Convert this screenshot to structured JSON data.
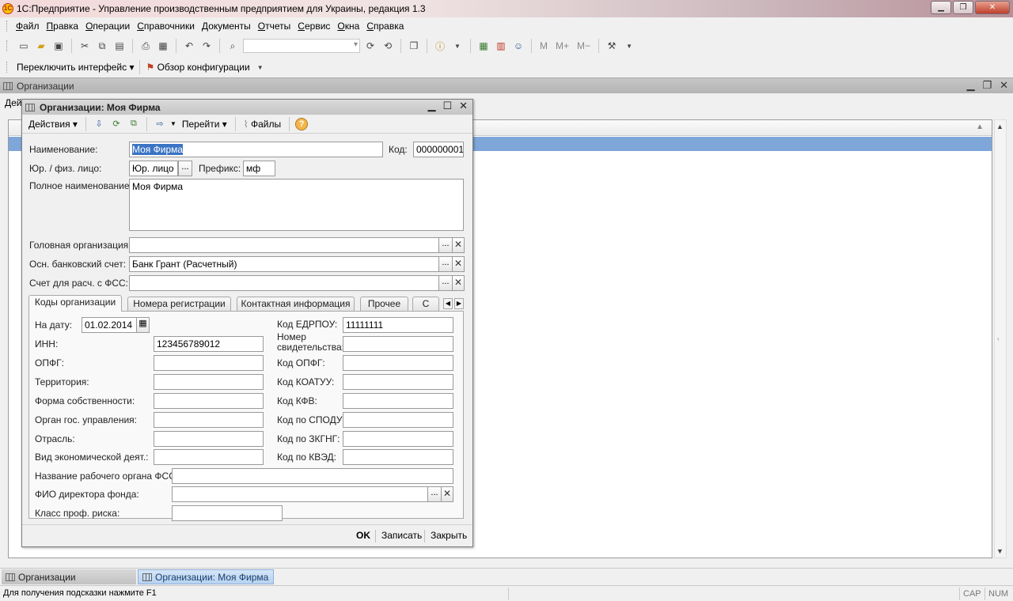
{
  "window": {
    "title": "1С:Предприятие - Управление производственным предприятием для Украины, редакция 1.3",
    "logo": "1С"
  },
  "menu": [
    "Файл",
    "Правка",
    "Операции",
    "Справочники",
    "Документы",
    "Отчеты",
    "Сервис",
    "Окна",
    "Справка"
  ],
  "toolbar": {
    "memory": [
      "M",
      "M+",
      "M−"
    ]
  },
  "toolbar2": {
    "switch_interface": "Переключить интерфейс",
    "config_overview": "Обзор конфигурации"
  },
  "list_window": {
    "title": "Организации",
    "actions_label": "Дей"
  },
  "form": {
    "title": "Организации: Моя Фирма",
    "toolbar": {
      "actions": "Действия",
      "goto": "Перейти",
      "files": "Файлы",
      "help": "?"
    },
    "fields": {
      "name_label": "Наименование:",
      "name_value": "Моя Фирма",
      "code_label": "Код:",
      "code_value": "000000001",
      "legal_type_label": "Юр. / физ. лицо:",
      "legal_type_value": "Юр. лицо",
      "prefix_label": "Префикс:",
      "prefix_value": "мф",
      "full_name_label": "Полное наименование:",
      "full_name_value": "Моя Фирма",
      "head_org_label": "Головная организация:",
      "head_org_value": "",
      "bank_account_label": "Осн. банковский счет:",
      "bank_account_value": "Банк Грант (Расчетный)",
      "fss_account_label": "Счет для расч. с ФСС:",
      "fss_account_value": ""
    },
    "tabs": [
      "Коды организации",
      "Номера регистрации",
      "Контактная информация",
      "Прочее",
      "С"
    ],
    "codes": {
      "date_label": "На дату:",
      "date_value": "01.02.2014",
      "edrpou_label": "Код ЕДРПОУ:",
      "edrpou_value": "11111111",
      "inn_label": "ИНН:",
      "inn_value": "123456789012",
      "cert_label_1": "Номер",
      "cert_label_2": "свидетельства:",
      "opfg_label": "ОПФГ:",
      "opfg_code_label": "Код ОПФГ:",
      "territory_label": "Территория:",
      "koatuu_label": "Код КОАТУУ:",
      "ownership_label": "Форма собственности:",
      "kfv_label": "Код КФВ:",
      "gov_body_label": "Орган гос. управления:",
      "spodu_label": "Код по СПОДУ:",
      "industry_label": "Отрасль:",
      "zkgng_label": "Код по ЗКГНГ:",
      "econ_activity_label": "Вид экономической деят.:",
      "kved_label": "Код по КВЭД:",
      "fss_body_label": "Название рабочего органа ФСС:",
      "fund_director_label": "ФИО директора фонда:",
      "risk_class_label": "Класс проф. риска:"
    },
    "footer": {
      "ok": "OK",
      "save": "Записать",
      "close": "Закрыть"
    }
  },
  "taskbar": [
    "Организации",
    "Организации: Моя Фирма"
  ],
  "status": {
    "hint": "Для получения подсказки нажмите F1",
    "cap": "CAP",
    "num": "NUM"
  }
}
